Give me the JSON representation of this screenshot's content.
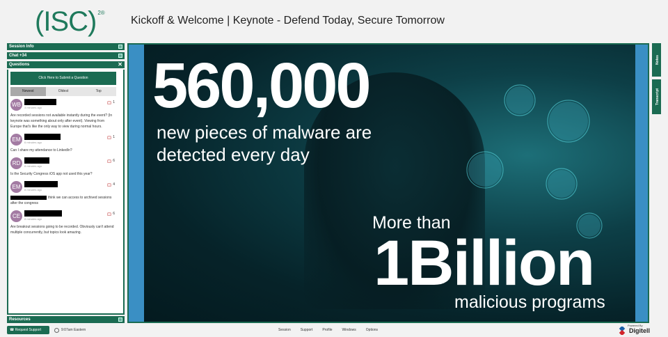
{
  "header": {
    "logo_text": "(ISC)",
    "logo_sup": "2®",
    "title": "Kickoff & Welcome | Keynote - Defend Today, Secure Tomorrow"
  },
  "panels": {
    "session_info": "Session Info",
    "chat": "Chat +34",
    "questions": "Questions",
    "resources": "Resources"
  },
  "questions": {
    "submit_label": "Click Here to Submit a Question",
    "tabs": [
      {
        "label": "Newest",
        "active": true
      },
      {
        "label": "Oldest",
        "active": false
      },
      {
        "label": "Top",
        "active": false
      }
    ],
    "items": [
      {
        "initials": "WB",
        "time": "3 minutes ago",
        "votes": "1",
        "text": "Are recorded sessions not available instantly during the event? (In keynote was something about only after event). Viewing from Europe that's like the only way to view during normal hours."
      },
      {
        "initials": "EM",
        "time": "6 minutes ago",
        "votes": "1",
        "text": "Can I share my attendance to LinkedIn?"
      },
      {
        "initials": "RD",
        "time": "8 minutes ago",
        "votes": "6",
        "text": "Is the Security Congress iOS app not used this year?"
      },
      {
        "initials": "EM",
        "time": "8 minutes ago",
        "votes": "4",
        "text": "think we can access to archived sessions after the congress"
      },
      {
        "initials": "CE",
        "time": "8 minutes ago",
        "votes": "6",
        "text": "Are breakout sessions going to be recorded. Obviously can't attend multiple concurrently, but topics look amazing."
      }
    ]
  },
  "slide": {
    "big_number": "560,000",
    "line1": "new pieces of malware are",
    "line2": "detected every day",
    "more_than": "More than",
    "billion": "1Billion",
    "malicious": "malicious programs"
  },
  "right_tabs": {
    "notes": "Notes",
    "transcript": "Transcript"
  },
  "footer": {
    "request_support": "Request Support",
    "clock": "9:07am Eastern",
    "menu": [
      "Session",
      "Support",
      "Profile",
      "Windows",
      "Options"
    ],
    "powered_by": "Powered By",
    "brand": "Digitell"
  },
  "colors": {
    "brand_green": "#1b6b52",
    "stage_blue": "#3a8fc4",
    "avatar_purple": "#a37ba3"
  }
}
